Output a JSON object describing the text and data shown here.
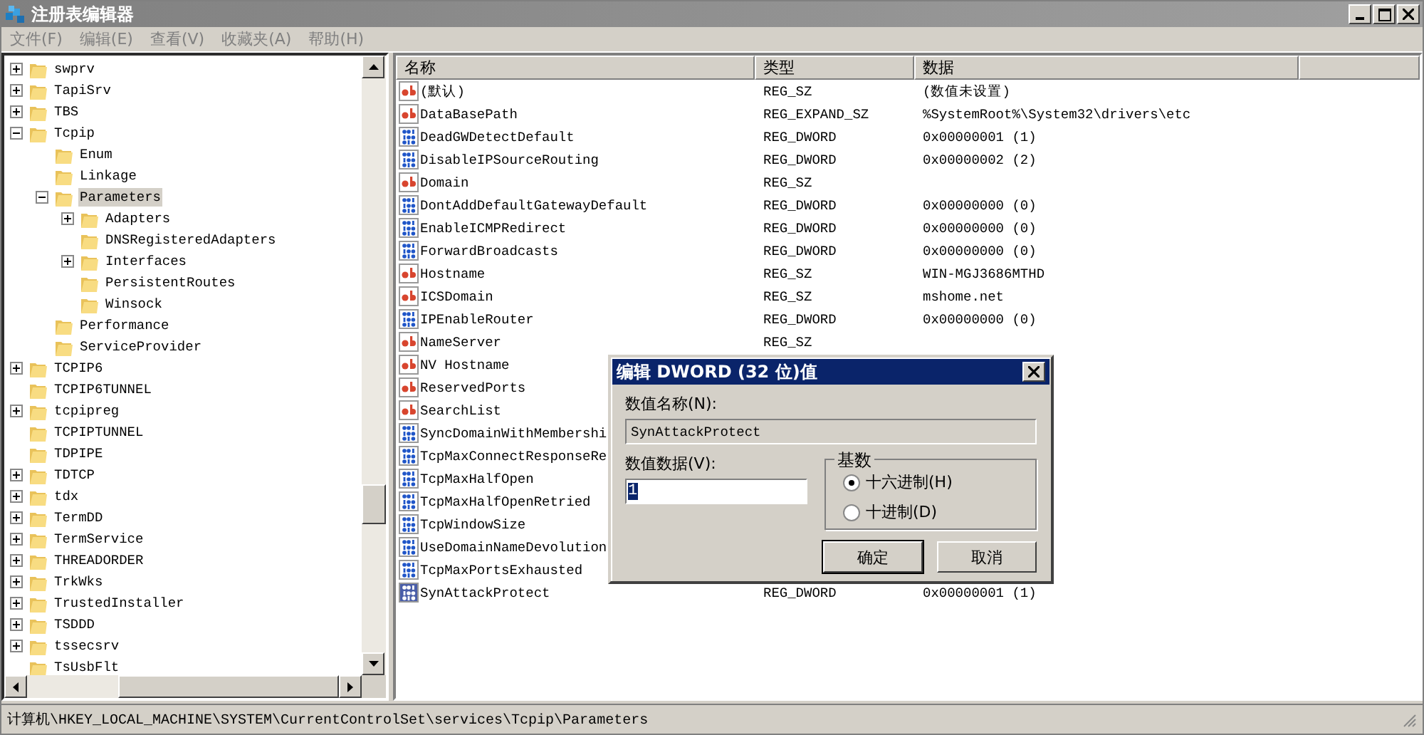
{
  "window": {
    "title": "注册表编辑器"
  },
  "menu": [
    "文件(F)",
    "编辑(E)",
    "查看(V)",
    "收藏夹(A)",
    "帮助(H)"
  ],
  "tree": [
    {
      "label": "swprv",
      "expanded": false,
      "selected": false
    },
    {
      "label": "TapiSrv",
      "expanded": false,
      "selected": false
    },
    {
      "label": "TBS",
      "expanded": false,
      "selected": false
    },
    {
      "label": "Tcpip",
      "expanded": true,
      "selected": false,
      "children": [
        {
          "label": "Enum",
          "selected": false
        },
        {
          "label": "Linkage",
          "selected": false
        },
        {
          "label": "Parameters",
          "expanded": true,
          "selected": true,
          "children": [
            {
              "label": "Adapters",
              "expanded": false,
              "selected": false
            },
            {
              "label": "DNSRegisteredAdapters",
              "selected": false
            },
            {
              "label": "Interfaces",
              "expanded": false,
              "selected": false
            },
            {
              "label": "PersistentRoutes",
              "selected": false
            },
            {
              "label": "Winsock",
              "selected": false
            }
          ]
        },
        {
          "label": "Performance",
          "selected": false
        },
        {
          "label": "ServiceProvider",
          "selected": false
        }
      ]
    },
    {
      "label": "TCPIP6",
      "expanded": false,
      "selected": false
    },
    {
      "label": "TCPIP6TUNNEL",
      "selected": false
    },
    {
      "label": "tcpipreg",
      "expanded": false,
      "selected": false
    },
    {
      "label": "TCPIPTUNNEL",
      "selected": false
    },
    {
      "label": "TDPIPE",
      "selected": false
    },
    {
      "label": "TDTCP",
      "expanded": false,
      "selected": false
    },
    {
      "label": "tdx",
      "expanded": false,
      "selected": false
    },
    {
      "label": "TermDD",
      "expanded": false,
      "selected": false
    },
    {
      "label": "TermService",
      "expanded": false,
      "selected": false
    },
    {
      "label": "THREADORDER",
      "expanded": false,
      "selected": false
    },
    {
      "label": "TrkWks",
      "expanded": false,
      "selected": false
    },
    {
      "label": "TrustedInstaller",
      "expanded": false,
      "selected": false
    },
    {
      "label": "TSDDD",
      "expanded": false,
      "selected": false
    },
    {
      "label": "tssecsrv",
      "expanded": false,
      "selected": false
    },
    {
      "label": "TsUsbFlt",
      "selected": false
    }
  ],
  "values": {
    "columns": [
      "名称",
      "类型",
      "数据"
    ],
    "rows": [
      {
        "kind": "string",
        "name": "(默认)",
        "type": "REG_SZ",
        "data": "(数值未设置)",
        "selected": false
      },
      {
        "kind": "string",
        "name": "DataBasePath",
        "type": "REG_EXPAND_SZ",
        "data": "%SystemRoot%\\System32\\drivers\\etc",
        "selected": false
      },
      {
        "kind": "dword",
        "name": "DeadGWDetectDefault",
        "type": "REG_DWORD",
        "data": "0x00000001 (1)",
        "selected": false
      },
      {
        "kind": "dword",
        "name": "DisableIPSourceRouting",
        "type": "REG_DWORD",
        "data": "0x00000002 (2)",
        "selected": false
      },
      {
        "kind": "string",
        "name": "Domain",
        "type": "REG_SZ",
        "selected": false
      },
      {
        "kind": "dword",
        "name": "DontAddDefaultGatewayDefault",
        "type": "REG_DWORD",
        "data": "0x00000000 (0)",
        "selected": false
      },
      {
        "kind": "dword",
        "name": "EnableICMPRedirect",
        "type": "REG_DWORD",
        "data": "0x00000000 (0)",
        "selected": false
      },
      {
        "kind": "dword",
        "name": "ForwardBroadcasts",
        "type": "REG_DWORD",
        "data": "0x00000000 (0)",
        "selected": false
      },
      {
        "kind": "string",
        "name": "Hostname",
        "type": "REG_SZ",
        "data": "WIN-MGJ3686MTHD",
        "selected": false
      },
      {
        "kind": "string",
        "name": "ICSDomain",
        "type": "REG_SZ",
        "data": "mshome.net",
        "selected": false
      },
      {
        "kind": "dword",
        "name": "IPEnableRouter",
        "type": "REG_DWORD",
        "data": "0x00000000 (0)",
        "selected": false
      },
      {
        "kind": "string",
        "name": "NameServer",
        "type": "REG_SZ",
        "selected": false
      },
      {
        "kind": "string",
        "name": "NV Hostname",
        "selected": false
      },
      {
        "kind": "string",
        "name": "ReservedPorts",
        "selected": false
      },
      {
        "kind": "string",
        "name": "SearchList",
        "selected": false
      },
      {
        "kind": "dword",
        "name": "SyncDomainWithMembershi",
        "selected": false
      },
      {
        "kind": "dword",
        "name": "TcpMaxConnectResponseRe",
        "selected": false
      },
      {
        "kind": "dword",
        "name": "TcpMaxHalfOpen",
        "selected": false
      },
      {
        "kind": "dword",
        "name": "TcpMaxHalfOpenRetried",
        "selected": false
      },
      {
        "kind": "dword",
        "name": "TcpWindowSize",
        "selected": false
      },
      {
        "kind": "dword",
        "name": "UseDomainNameDevolution",
        "selected": false
      },
      {
        "kind": "dword",
        "name": "TcpMaxPortsExhausted",
        "selected": false
      },
      {
        "kind": "dword",
        "name": "SynAttackProtect",
        "type": "REG_DWORD",
        "data": "0x00000001 (1)",
        "selected": true
      }
    ]
  },
  "status_bar": "计算机\\HKEY_LOCAL_MACHINE\\SYSTEM\\CurrentControlSet\\services\\Tcpip\\Parameters",
  "dialog": {
    "title": "编辑 DWORD (32 位)值",
    "name_label": "数值名称(N):",
    "name_value": "SynAttackProtect",
    "data_label": "数值数据(V):",
    "data_value": "1",
    "base_label": "基数",
    "bases": [
      {
        "label": "十六进制(H)",
        "selected": true
      },
      {
        "label": "十进制(D)",
        "selected": false
      }
    ],
    "buttons": [
      "确定",
      "取消"
    ]
  }
}
